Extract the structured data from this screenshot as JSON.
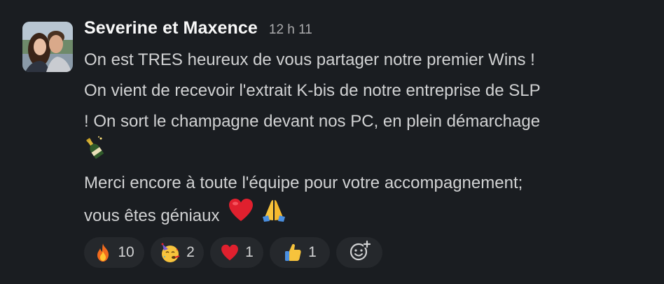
{
  "message": {
    "author": "Severine et Maxence",
    "timestamp": "12 h 11",
    "lines": [
      "On est TRES heureux de vous partager notre premier Wins !",
      "On vient de recevoir l'extrait K-bis de notre entreprise de SLP",
      "! On sort le champagne devant nos PC, en plein démarchage",
      "Merci encore à toute l'équipe pour votre accompagnement;",
      "vous êtes géniaux"
    ],
    "inline_emojis": [
      "champagne-bottle-icon",
      "red-heart-icon",
      "folded-hands-icon"
    ]
  },
  "reactions": [
    {
      "icon": "fire-icon",
      "count": "10"
    },
    {
      "icon": "partying-face-icon",
      "count": "2"
    },
    {
      "icon": "red-heart-icon",
      "count": "1"
    },
    {
      "icon": "thumbs-up-icon",
      "count": "1"
    }
  ],
  "add_reaction": {
    "icon": "add-reaction-icon"
  },
  "colors": {
    "background": "#1a1d21",
    "text": "#d1d2d3",
    "author": "#f8f8f8",
    "timestamp": "#ababad",
    "reaction_pill": "#25282c"
  }
}
